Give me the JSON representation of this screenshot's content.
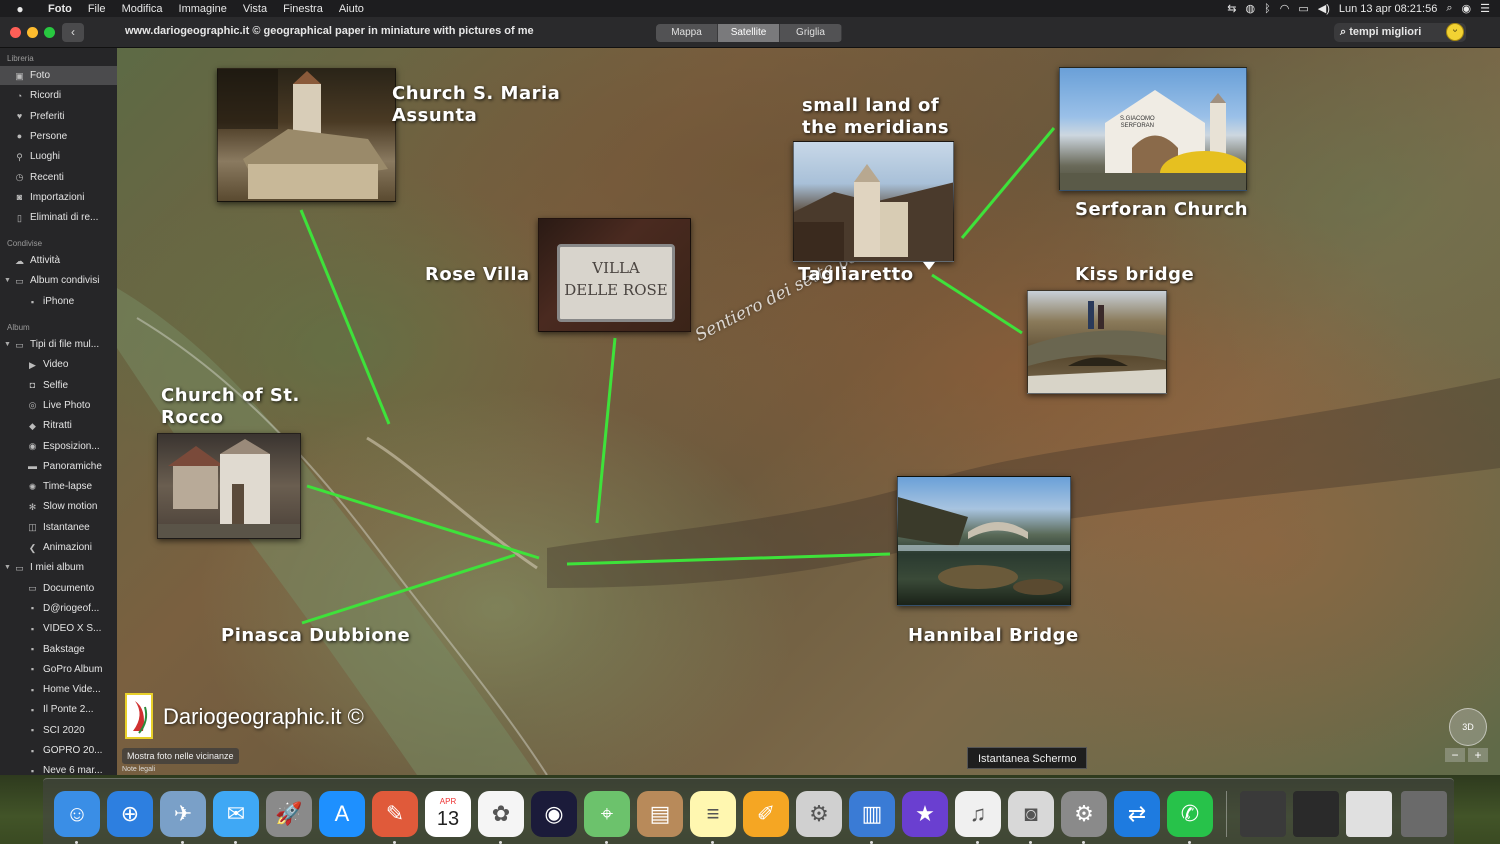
{
  "menubar": {
    "app": "Foto",
    "items": [
      "File",
      "Modifica",
      "Immagine",
      "Vista",
      "Finestra",
      "Aiuto"
    ],
    "clock": "Lun 13 apr  08:21:56"
  },
  "toolbar": {
    "back_glyph": "‹",
    "title": "www.dariogeographic.it © geographical paper in miniature with pictures of me",
    "segments": [
      "Mappa",
      "Satellite",
      "Griglia"
    ],
    "active_segment": "Satellite",
    "search_value": "tempi migliori"
  },
  "sidebar": {
    "libreria_title": "Libreria",
    "libreria": [
      {
        "label": "Foto",
        "icon": "photos-icon",
        "selected": true
      },
      {
        "label": "Ricordi",
        "icon": "memories-icon"
      },
      {
        "label": "Preferiti",
        "icon": "heart-icon"
      },
      {
        "label": "Persone",
        "icon": "person-icon"
      },
      {
        "label": "Luoghi",
        "icon": "pin-icon"
      },
      {
        "label": "Recenti",
        "icon": "recent-icon"
      },
      {
        "label": "Importazioni",
        "icon": "import-icon"
      },
      {
        "label": "Eliminati di re...",
        "icon": "trash-icon"
      }
    ],
    "condivise_title": "Condivise",
    "condivise": [
      {
        "label": "Attività",
        "icon": "cloud-icon"
      },
      {
        "label": "Album condivisi",
        "icon": "folder-icon"
      },
      {
        "label": "iPhone",
        "icon": "album-icon"
      }
    ],
    "album_title": "Album",
    "album": [
      {
        "label": "Tipi di file mul...",
        "icon": "folder-icon"
      },
      {
        "label": "Video",
        "icon": "video-icon"
      },
      {
        "label": "Selfie",
        "icon": "selfie-icon"
      },
      {
        "label": "Live Photo",
        "icon": "live-photo-icon"
      },
      {
        "label": "Ritratti",
        "icon": "cube-icon"
      },
      {
        "label": "Esposizion...",
        "icon": "exposure-icon"
      },
      {
        "label": "Panoramiche",
        "icon": "panorama-icon"
      },
      {
        "label": "Time-lapse",
        "icon": "timelapse-icon"
      },
      {
        "label": "Slow motion",
        "icon": "slowmo-icon"
      },
      {
        "label": "Istantanee",
        "icon": "screenshot-icon"
      },
      {
        "label": "Animazioni",
        "icon": "animation-icon"
      },
      {
        "label": "I miei album",
        "icon": "folder-icon"
      },
      {
        "label": "Documento",
        "icon": "folder-icon"
      },
      {
        "label": "D@riogeof...",
        "icon": "album-icon"
      },
      {
        "label": "VIDEO X S...",
        "icon": "album-icon"
      },
      {
        "label": "Bakstage",
        "icon": "album-icon"
      },
      {
        "label": "GoPro Album",
        "icon": "album-icon"
      },
      {
        "label": "Home Vide...",
        "icon": "album-icon"
      },
      {
        "label": "Il Ponte 2...",
        "icon": "album-icon"
      },
      {
        "label": "SCI 2020",
        "icon": "album-icon"
      },
      {
        "label": "GOPRO 20...",
        "icon": "album-icon"
      },
      {
        "label": "Neve 6 mar...",
        "icon": "album-icon"
      }
    ]
  },
  "map": {
    "route_label": "Sentiero dei sette ponti",
    "brand": "Dariogeographic.it ©",
    "nearby_button": "Mostra foto nelle vicinanze",
    "legal": "Note legali",
    "compass_label": "3D",
    "zoom_out": "−",
    "zoom_in": "+",
    "tooltip": "Istantanea Schermo",
    "line_color": "#3ee23a",
    "places": [
      {
        "id": "church-s-maria",
        "label": "Church S. Maria\nAssunta"
      },
      {
        "id": "small-land",
        "label": "small land of\nthe meridians"
      },
      {
        "id": "serforan",
        "label": "Serforan Church"
      },
      {
        "id": "rose-villa",
        "label": "Rose Villa"
      },
      {
        "id": "tagliaretto",
        "label": "Tagliaretto"
      },
      {
        "id": "kiss-bridge",
        "label": "Kiss bridge"
      },
      {
        "id": "st-rocco",
        "label": "Church of St.\nRocco"
      },
      {
        "id": "pinasca",
        "label": "Pinasca Dubbione"
      },
      {
        "id": "hannibal",
        "label": "Hannibal Bridge"
      }
    ],
    "sign_text": "VILLA\nDELLE ROSE",
    "serforan_sign": "S.GIACOMO\nSERFORAN"
  },
  "dock": {
    "calendar_month": "APR",
    "calendar_day": "13",
    "apps": [
      {
        "name": "finder-icon",
        "color": "#3a8ee6"
      },
      {
        "name": "safari-icon",
        "color": "#2d7fe0"
      },
      {
        "name": "preview-eagle-icon",
        "color": "#7aa0c8"
      },
      {
        "name": "messages-icon",
        "color": "#3fa8f5"
      },
      {
        "name": "launchpad-icon",
        "color": "#8a8a8a"
      },
      {
        "name": "app-store-icon",
        "color": "#1e90ff"
      },
      {
        "name": "pixelmator-icon",
        "color": "#e05a3a"
      },
      {
        "name": "calendar-icon",
        "color": "#ffffff"
      },
      {
        "name": "photos-icon",
        "color": "#f5f5f5"
      },
      {
        "name": "siri-icon",
        "color": "#1b1b3a"
      },
      {
        "name": "maps-icon",
        "color": "#6cc26c"
      },
      {
        "name": "contacts-icon",
        "color": "#b88a5a"
      },
      {
        "name": "notes-icon",
        "color": "#fff7b0"
      },
      {
        "name": "pages-icon",
        "color": "#f5a623"
      },
      {
        "name": "script-editor-icon",
        "color": "#d0d0d0"
      },
      {
        "name": "keynote-icon",
        "color": "#3a7bd5"
      },
      {
        "name": "imovie-icon",
        "color": "#6a3fd0"
      },
      {
        "name": "itunes-icon",
        "color": "#f0f0f0"
      },
      {
        "name": "screenshot-icon",
        "color": "#d8d8d8"
      },
      {
        "name": "system-preferences-icon",
        "color": "#8a8a8a"
      },
      {
        "name": "teamviewer-icon",
        "color": "#1e7be0"
      },
      {
        "name": "whatsapp-icon",
        "color": "#27c24a"
      }
    ]
  }
}
